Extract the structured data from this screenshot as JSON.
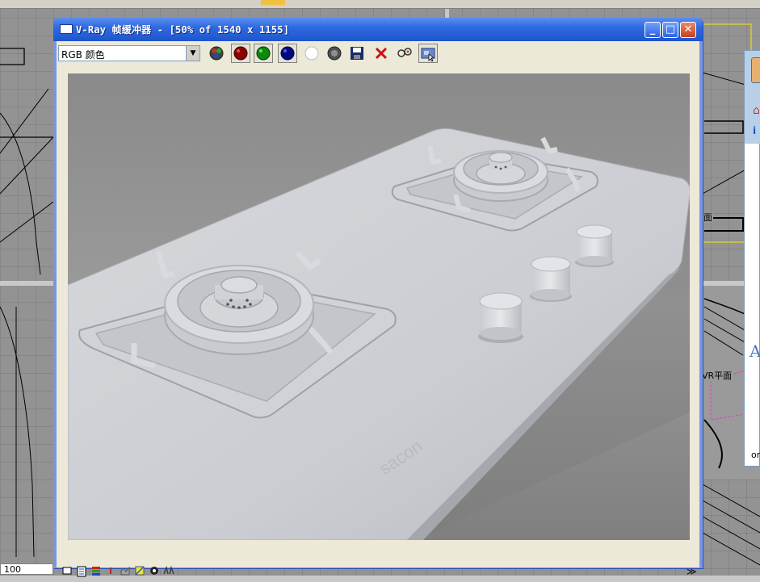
{
  "window": {
    "title": "V-Ray 帧缓冲器 - [50% of 1540 x 1155]",
    "buttons": {
      "minimize": "_",
      "maximize": "□",
      "close": "✕"
    }
  },
  "toolbar": {
    "channel": {
      "selected": "RGB 颜色",
      "options": [
        "RGB 颜色"
      ]
    },
    "tools": [
      "rgb-channels-icon",
      "red-channel-icon",
      "green-channel-icon",
      "blue-channel-icon",
      "alpha-channel-icon",
      "monochrome-icon",
      "save-image-icon",
      "clear-image-icon",
      "link-to-vfb-icon",
      "region-render-icon"
    ]
  },
  "render": {
    "brand_text": "sacon"
  },
  "statusbar": {
    "info_glyph": "i",
    "expand": "≫"
  },
  "background": {
    "status_value": "100",
    "viewport_labels": [
      "面",
      "VR平面"
    ],
    "side_panel": {
      "home_glyph": "⌂",
      "info_glyph": "i",
      "big_letter": "A",
      "text": "or"
    }
  },
  "colors": {
    "titlebar": "#2f6ae0",
    "close_button": "#c8401c",
    "window_body": "#ece9d8",
    "render_bg": "#8c8c8c"
  }
}
